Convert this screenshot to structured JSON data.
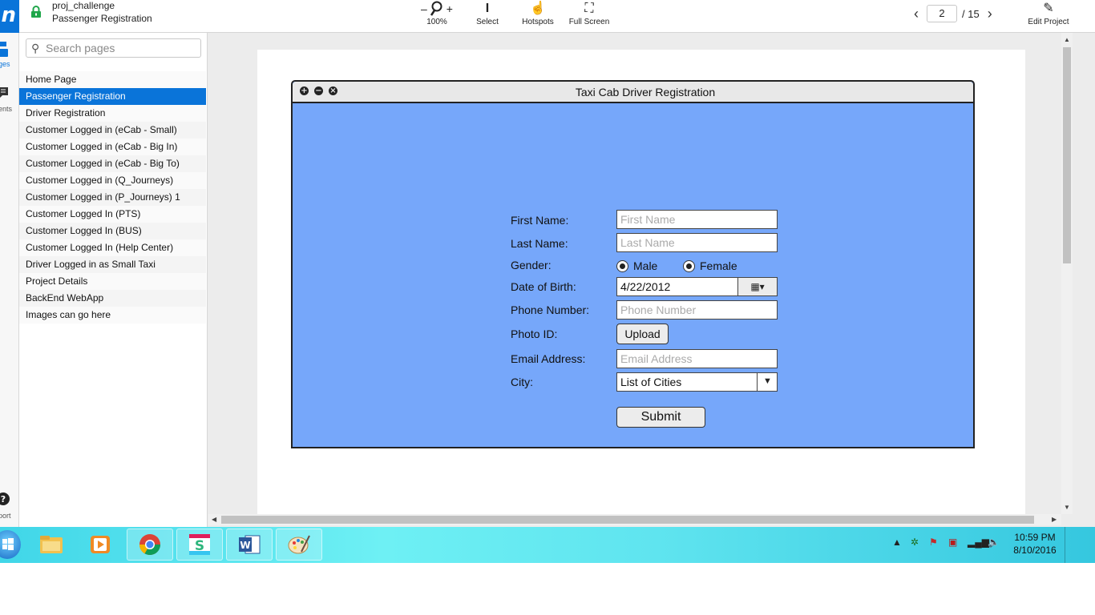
{
  "header": {
    "project_name": "proj_challenge",
    "page_name": "Passenger Registration",
    "zoom": {
      "minus": "–",
      "plus": "+",
      "level": "100%"
    },
    "tools": {
      "select": "Select",
      "hotspots": "Hotspots",
      "fullscreen": "Full Screen",
      "edit": "Edit Project"
    },
    "pager": {
      "current": "2",
      "total": "/ 15"
    }
  },
  "rail": {
    "pages_label": "ges",
    "comments_label": "ents",
    "support_label": "port"
  },
  "sidebar": {
    "search_placeholder": "Search pages",
    "pages": [
      "Home Page",
      "Passenger Registration",
      "Driver Registration",
      "Customer Logged in (eCab - Small)",
      "Customer Logged in (eCab - Big In)",
      "Customer Logged in (eCab - Big To)",
      "Customer Logged in (Q_Journeys)",
      "Customer Logged in (P_Journeys) 1",
      "Customer Logged In (PTS)",
      "Customer Logged In (BUS)",
      "Customer Logged In (Help Center)",
      "Driver Logged in as Small Taxi",
      "Project Details",
      "BackEnd WebApp",
      "Images can go here"
    ],
    "selected_index": 1
  },
  "mockup": {
    "title": "Taxi Cab Driver Registration",
    "form": {
      "first_name_label": "First Name:",
      "first_name_placeholder": "First Name",
      "last_name_label": "Last Name:",
      "last_name_placeholder": "Last Name",
      "gender_label": "Gender:",
      "gender_male": "Male",
      "gender_female": "Female",
      "dob_label": "Date of Birth:",
      "dob_value": "4/22/2012",
      "phone_label": "Phone Number:",
      "phone_placeholder": "Phone Number",
      "photo_label": "Photo ID:",
      "upload_button": "Upload",
      "email_label": "Email Address:",
      "email_placeholder": "Email Address",
      "city_label": "City:",
      "city_value": "List of Cities",
      "submit_button": "Submit"
    }
  },
  "taskbar": {
    "time": "10:59 PM",
    "date": "8/10/2016"
  },
  "colors": {
    "accent": "#0a74d9",
    "mockup_bg": "#76a7fa",
    "taskbar": "#5fe4ef"
  }
}
